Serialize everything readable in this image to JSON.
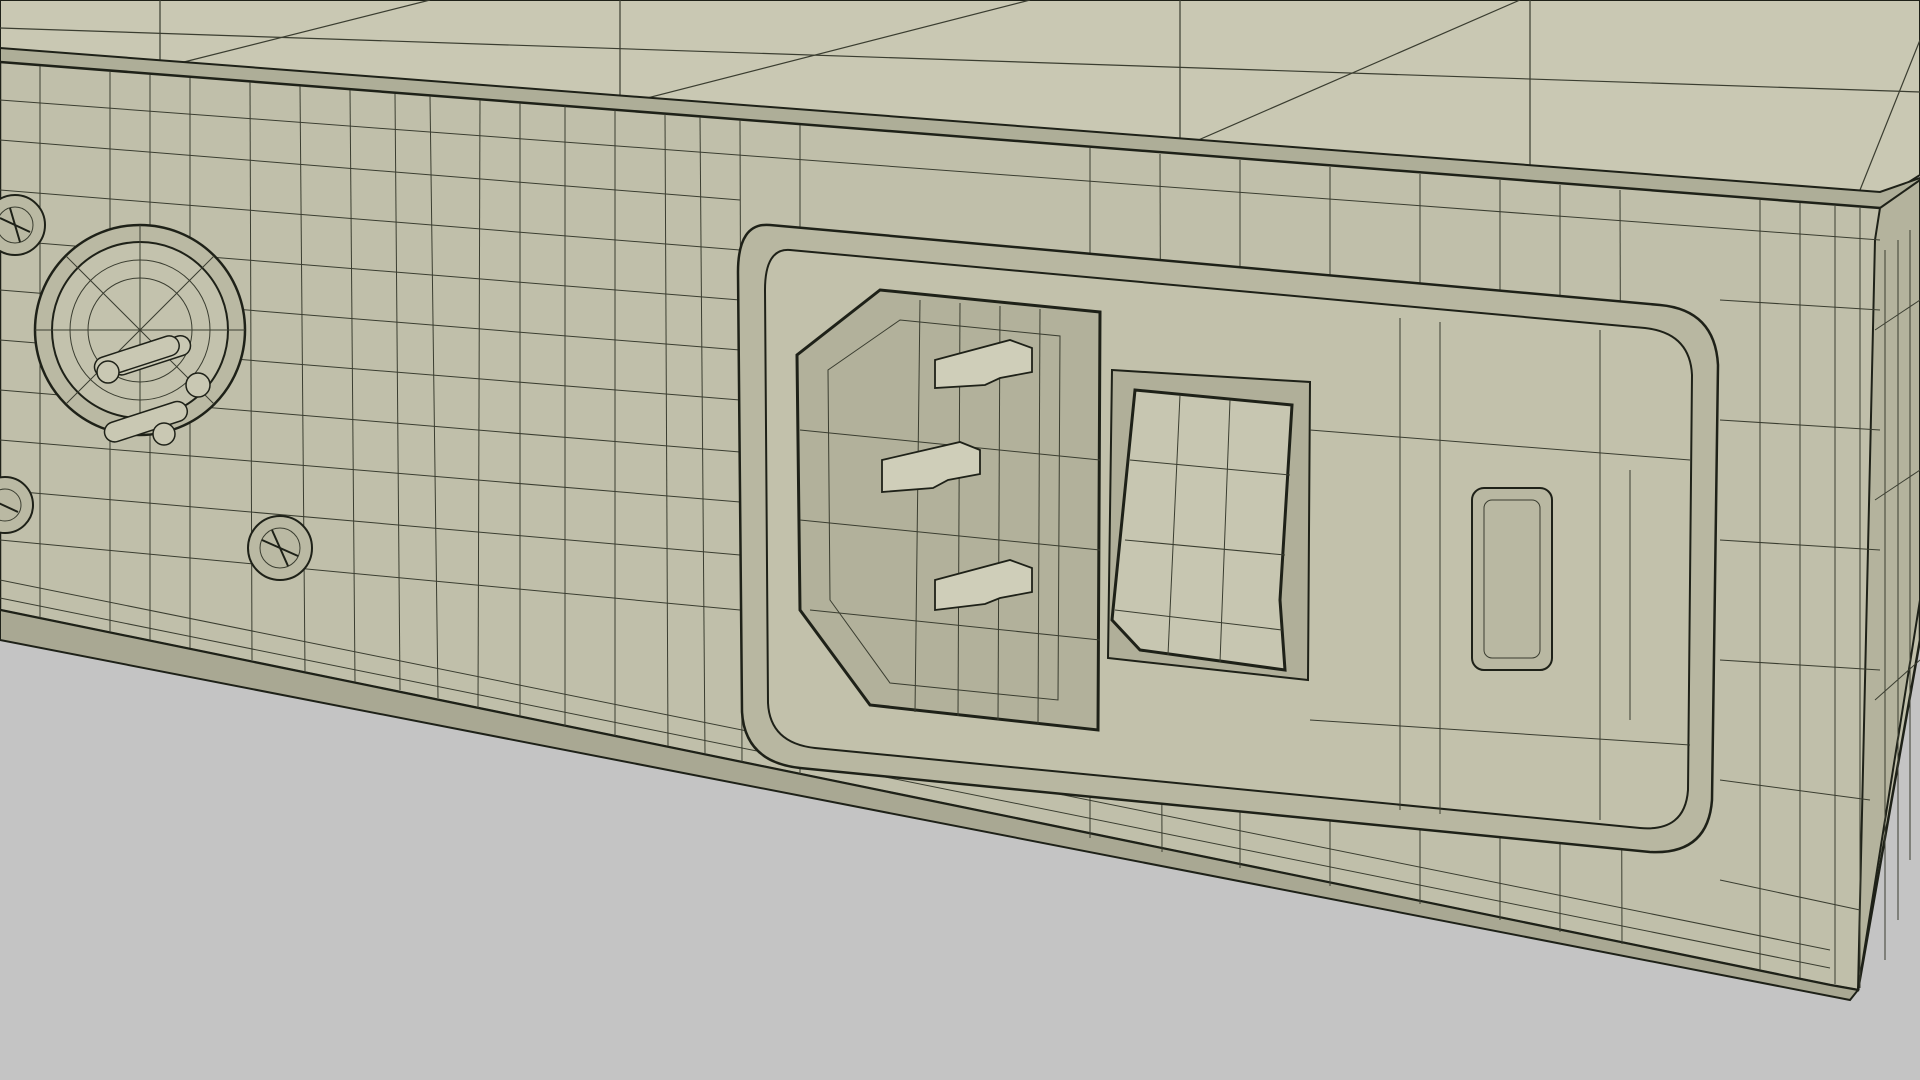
{
  "scene": {
    "subject": "wireframe-render",
    "colors": {
      "background": "#c4c4c4",
      "surface": "#c0bfaa",
      "surface_dark": "#b4b39d",
      "surface_top": "#c9c8b3",
      "edge_line": "#1e2118",
      "mesh_line": "#3a3d30"
    }
  }
}
